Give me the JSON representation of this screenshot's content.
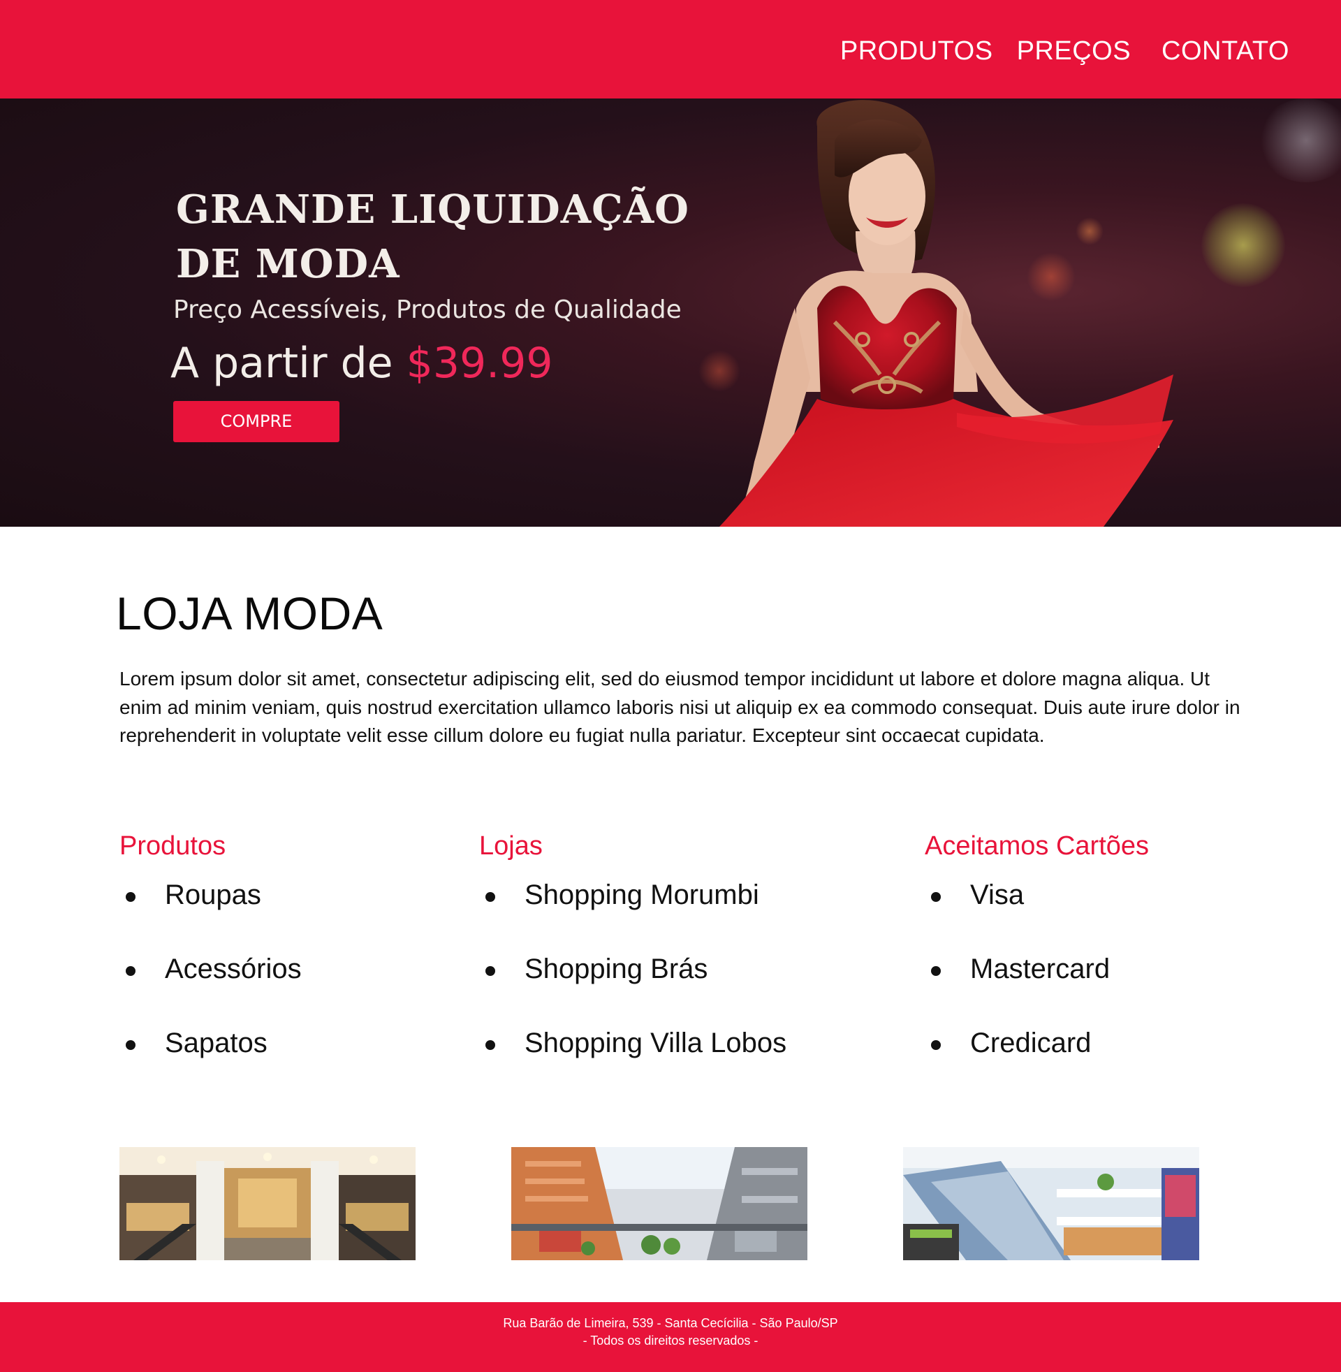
{
  "nav": {
    "items": [
      "PRODUTOS",
      "PREÇOS",
      "CONTATO"
    ]
  },
  "hero": {
    "title_line1": "GRANDE LIQUIDAÇÃO",
    "title_line2": "DE MODA",
    "subtitle": "Preço Acessíveis, Produtos de Qualidade",
    "price_prefix": "A partir de ",
    "price": "$39.99",
    "button_label": "COMPRE"
  },
  "main": {
    "title": "LOJA MODA",
    "intro": "Lorem ipsum dolor sit amet, consectetur adipiscing elit, sed do eiusmod tempor incididunt ut labore et dolore magna aliqua. Ut enim ad minim veniam, quis nostrud exercitation ullamco laboris nisi ut aliquip ex ea commodo consequat. Duis aute irure dolor in reprehenderit in voluptate velit esse cillum dolore eu fugiat nulla pariatur. Excepteur sint occaecat cupidata."
  },
  "columns": [
    {
      "heading": "Produtos",
      "items": [
        "Roupas",
        "Acessórios",
        "Sapatos"
      ]
    },
    {
      "heading": "Lojas",
      "items": [
        "Shopping Morumbi",
        "Shopping Brás",
        "Shopping Villa Lobos"
      ]
    },
    {
      "heading": "Aceitamos Cartões",
      "items": [
        "Visa",
        "Mastercard",
        "Credicard"
      ]
    }
  ],
  "footer": {
    "address": "Rua Barão de Limeira, 539 - Santa Cecícilia - São Paulo/SP",
    "rights": "- Todos os direitos reservados -"
  },
  "colors": {
    "brand": "#e8133a",
    "hero_bg": "#24101a",
    "text": "#111111",
    "price": "#f0285a"
  },
  "icons": [
    "bullet-dot"
  ]
}
